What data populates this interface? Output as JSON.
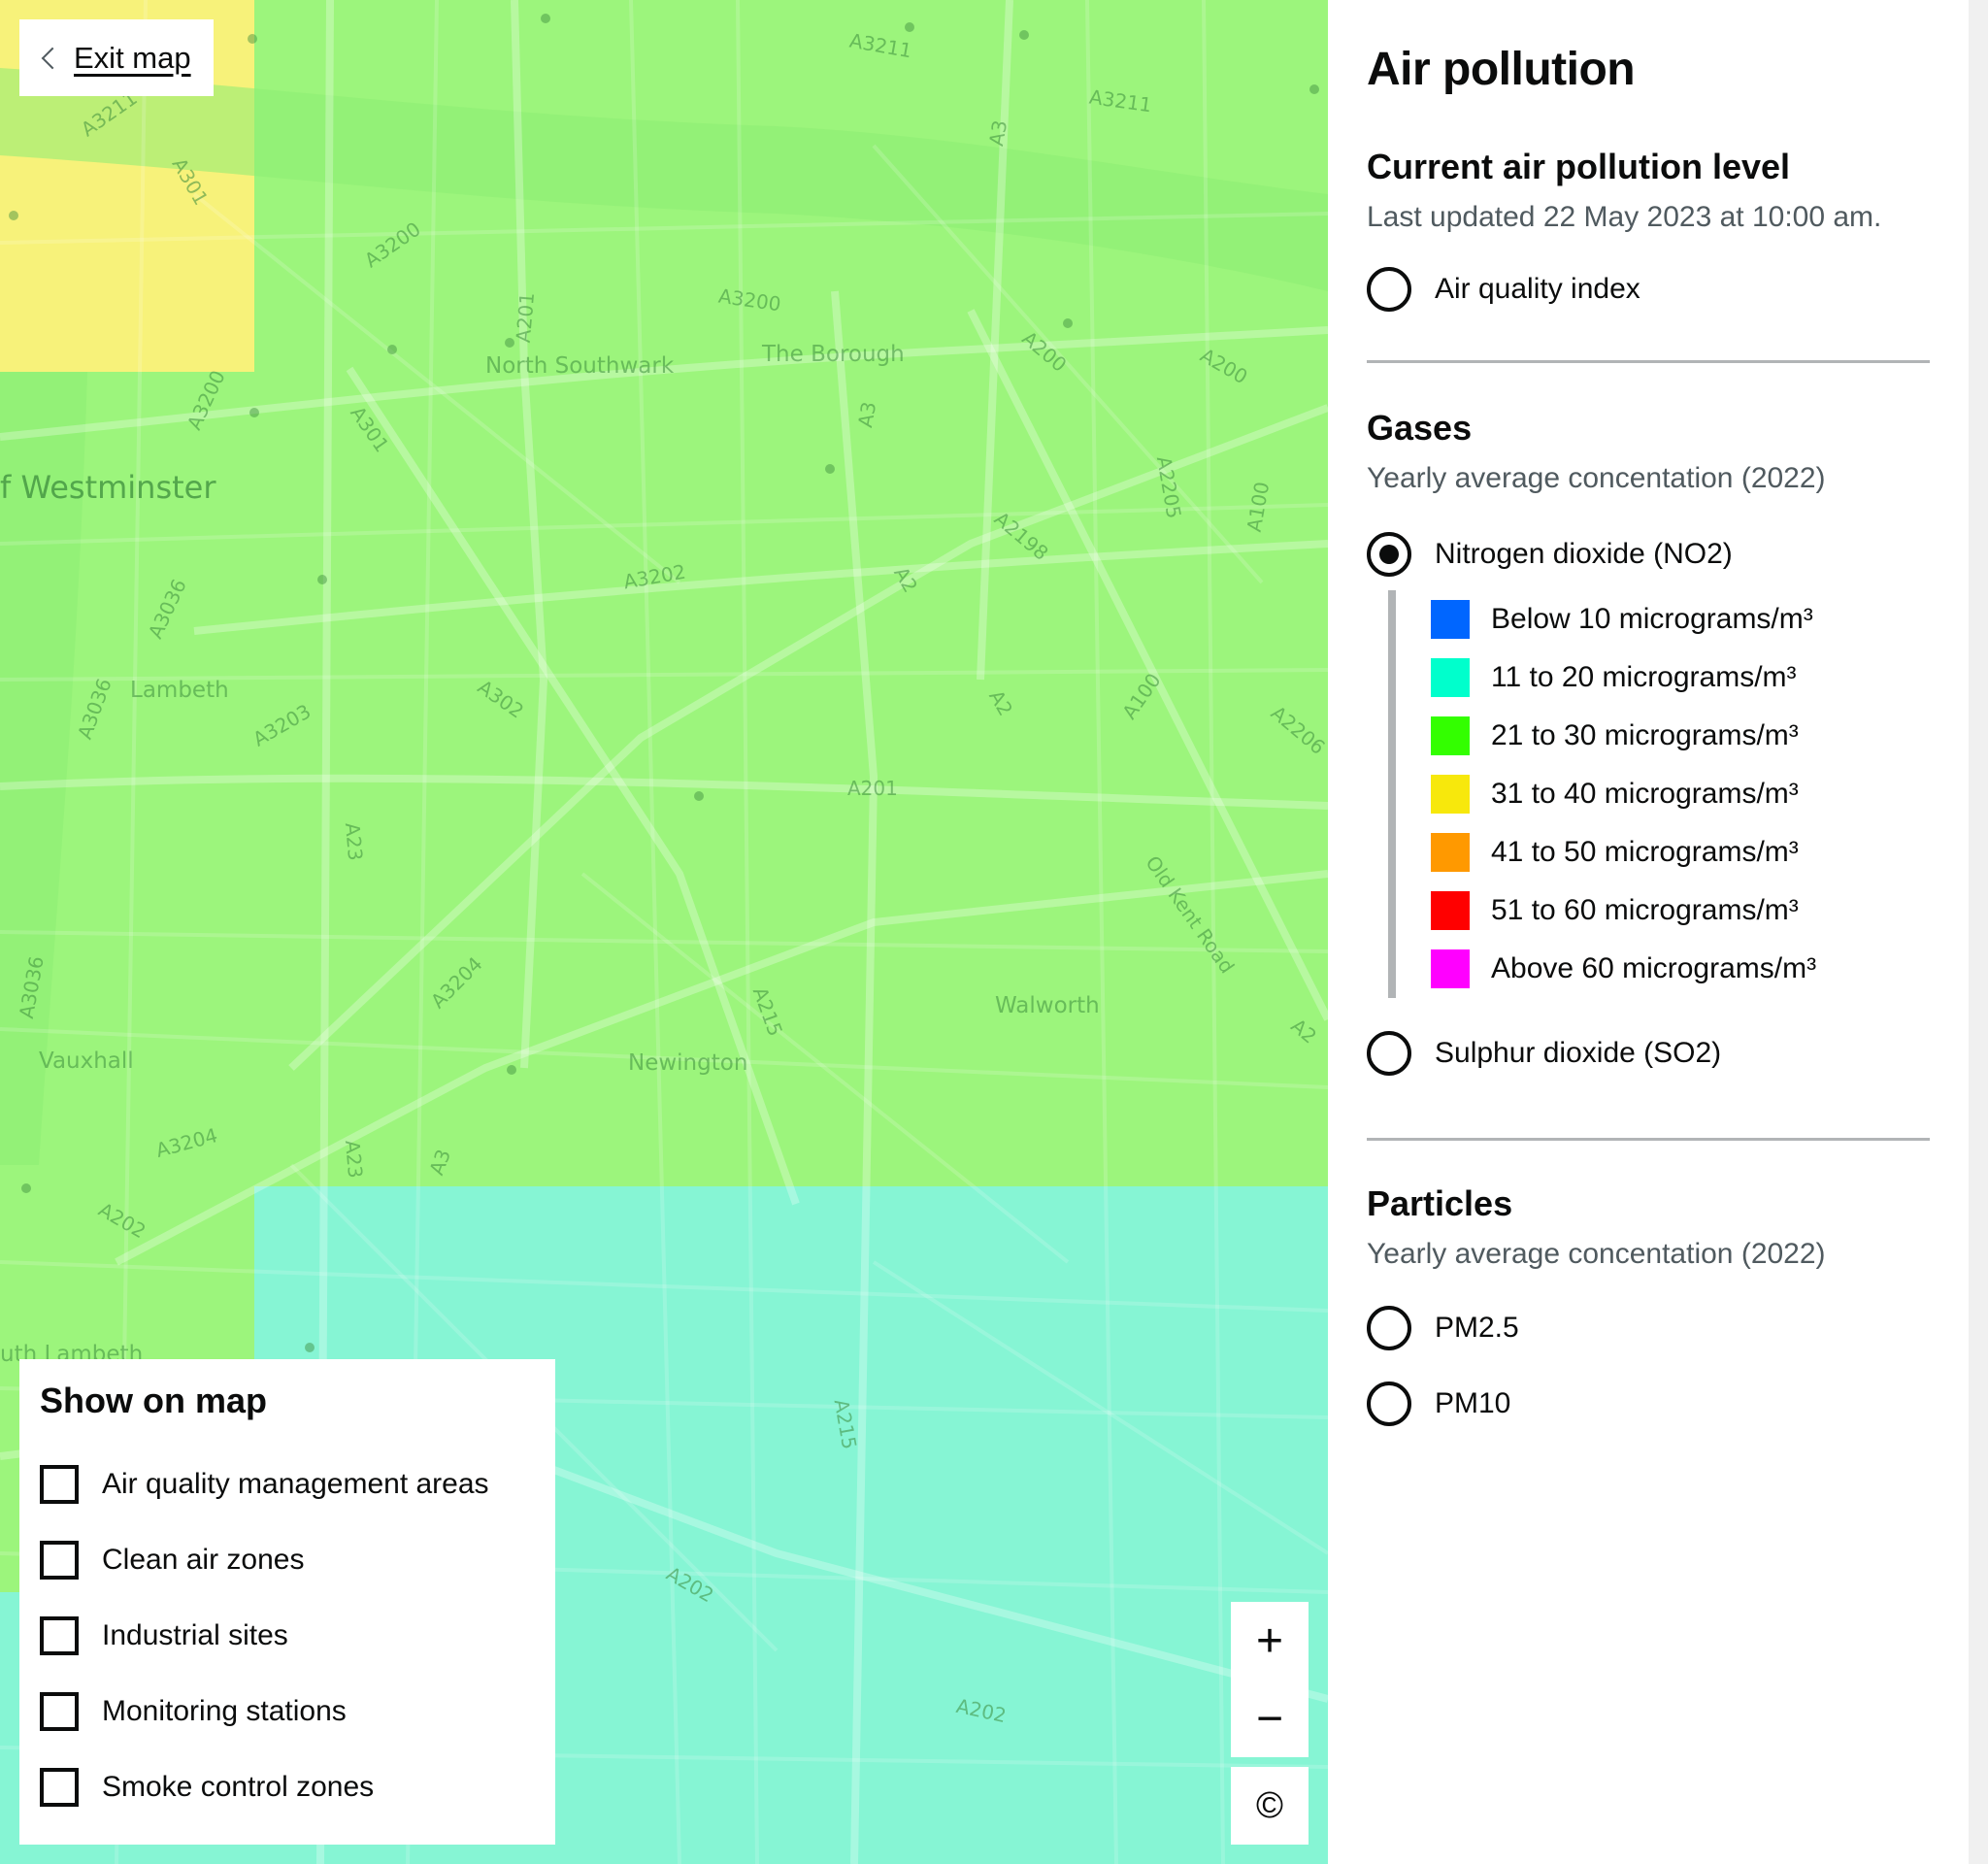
{
  "map": {
    "exit_label": "Exit map",
    "zone_colors": {
      "yellow": "#f7f27a",
      "green": "#9cf57c",
      "teal": "#86f5d4",
      "river": "#8ced73"
    },
    "place_labels": [
      {
        "text": "f Westminster",
        "kind": "big"
      },
      {
        "text": "North Southwark",
        "kind": "place"
      },
      {
        "text": "The Borough",
        "kind": "place"
      },
      {
        "text": "Lambeth",
        "kind": "place"
      },
      {
        "text": "Vauxhall",
        "kind": "place"
      },
      {
        "text": "Newington",
        "kind": "place"
      },
      {
        "text": "Walworth",
        "kind": "place"
      },
      {
        "text": "uth Lambeth",
        "kind": "place"
      }
    ],
    "road_labels": [
      "A3211",
      "A3211",
      "A301",
      "A3211",
      "A3",
      "A3200",
      "A201",
      "A3200",
      "A200",
      "A200",
      "A3200",
      "A301",
      "A3",
      "A2205",
      "A100",
      "A2198",
      "A3036",
      "A3202",
      "A2",
      "A3036",
      "A302",
      "A3203",
      "A2",
      "A100",
      "A2206",
      "A201",
      "A23",
      "Old Kent Road",
      "A3204",
      "A215",
      "A2",
      "A3036",
      "A3204",
      "A23",
      "A3",
      "A202",
      "A215",
      "A202",
      "A202"
    ],
    "zoom_in_label": "+",
    "zoom_out_label": "−",
    "attribution_label": "©"
  },
  "layers_panel": {
    "title": "Show on map",
    "items": [
      {
        "label": "Air quality management areas",
        "checked": false
      },
      {
        "label": "Clean air zones",
        "checked": false
      },
      {
        "label": "Industrial sites",
        "checked": false
      },
      {
        "label": "Monitoring stations",
        "checked": false
      },
      {
        "label": "Smoke control zones",
        "checked": false
      }
    ]
  },
  "panel": {
    "title": "Air pollution",
    "current": {
      "heading": "Current air pollution level",
      "updated": "Last updated 22 May 2023 at 10:00 am.",
      "options": [
        {
          "label": "Air quality index",
          "checked": false
        }
      ]
    },
    "gases": {
      "heading": "Gases",
      "hint": "Yearly average concentation (2022)",
      "options": [
        {
          "label": "Nitrogen dioxide (NO2)",
          "checked": true
        },
        {
          "label": "Sulphur dioxide (SO2)",
          "checked": false
        }
      ],
      "legend": [
        {
          "label": "Below 10 micrograms/m³",
          "color": "#0066ff"
        },
        {
          "label": "11 to 20 micrograms/m³",
          "color": "#00ffcc"
        },
        {
          "label": "21 to 30 micrograms/m³",
          "color": "#33ff00"
        },
        {
          "label": "31 to 40 micrograms/m³",
          "color": "#f7e80c"
        },
        {
          "label": "41 to 50 micrograms/m³",
          "color": "#ff9900"
        },
        {
          "label": "51 to 60 micrograms/m³",
          "color": "#ff0000"
        },
        {
          "label": "Above 60 micrograms/m³",
          "color": "#ff00ff"
        }
      ]
    },
    "particles": {
      "heading": "Particles",
      "hint": "Yearly average concentation (2022)",
      "options": [
        {
          "label": "PM2.5",
          "checked": false
        },
        {
          "label": "PM10",
          "checked": false
        }
      ]
    }
  }
}
